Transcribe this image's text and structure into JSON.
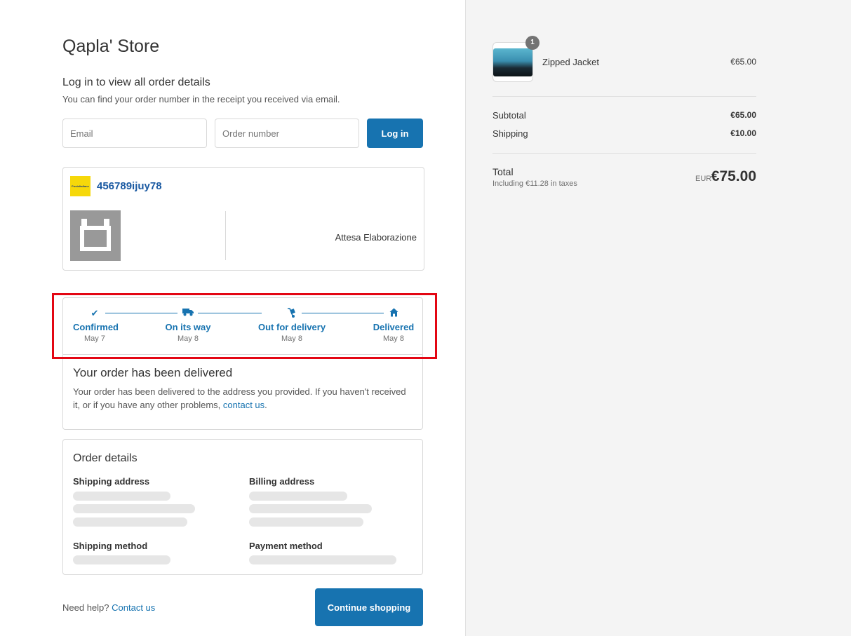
{
  "store": {
    "name": "Qapla' Store"
  },
  "login": {
    "title": "Log in to view all order details",
    "subtitle": "You can find your order number in the receipt you received via email.",
    "email_placeholder": "Email",
    "order_placeholder": "Order number",
    "button_label": "Log in"
  },
  "tracking": {
    "number": "456789ijuy78",
    "status": "Attesa Elaborazione",
    "carrier_logo_text": "PosteItaliane"
  },
  "timeline": {
    "steps": [
      {
        "label": "Confirmed",
        "date": "May 7",
        "icon": "check-icon"
      },
      {
        "label": "On its way",
        "date": "May 8",
        "icon": "truck-icon"
      },
      {
        "label": "Out for delivery",
        "date": "May 8",
        "icon": "hand-truck-icon"
      },
      {
        "label": "Delivered",
        "date": "May 8",
        "icon": "home-icon"
      }
    ],
    "accent_color": "#1773b0"
  },
  "delivery": {
    "title": "Your order has been delivered",
    "text": "Your order has been delivered to the address you provided. If you haven't received it, or if you have any other problems,",
    "link": "contact us",
    "period": "."
  },
  "order_details": {
    "title": "Order details",
    "shipping_address": "Shipping address",
    "billing_address": "Billing address",
    "shipping_method": "Shipping method",
    "payment_method": "Payment method"
  },
  "footer": {
    "help_text": "Need help?",
    "help_link": "Contact us",
    "continue_label": "Continue shopping"
  },
  "summary": {
    "product": {
      "name": "Zipped Jacket",
      "price": "€65.00",
      "quantity": "1"
    },
    "subtotal_label": "Subtotal",
    "subtotal_value": "€65.00",
    "shipping_label": "Shipping",
    "shipping_value": "€10.00",
    "total_label": "Total",
    "tax_note": "Including €11.28 in taxes",
    "currency": "EUR",
    "total_value": "€75.00"
  },
  "colors": {
    "primary": "#1773b0",
    "highlight": "#e30613",
    "sidebar_bg": "#f4f4f4"
  }
}
